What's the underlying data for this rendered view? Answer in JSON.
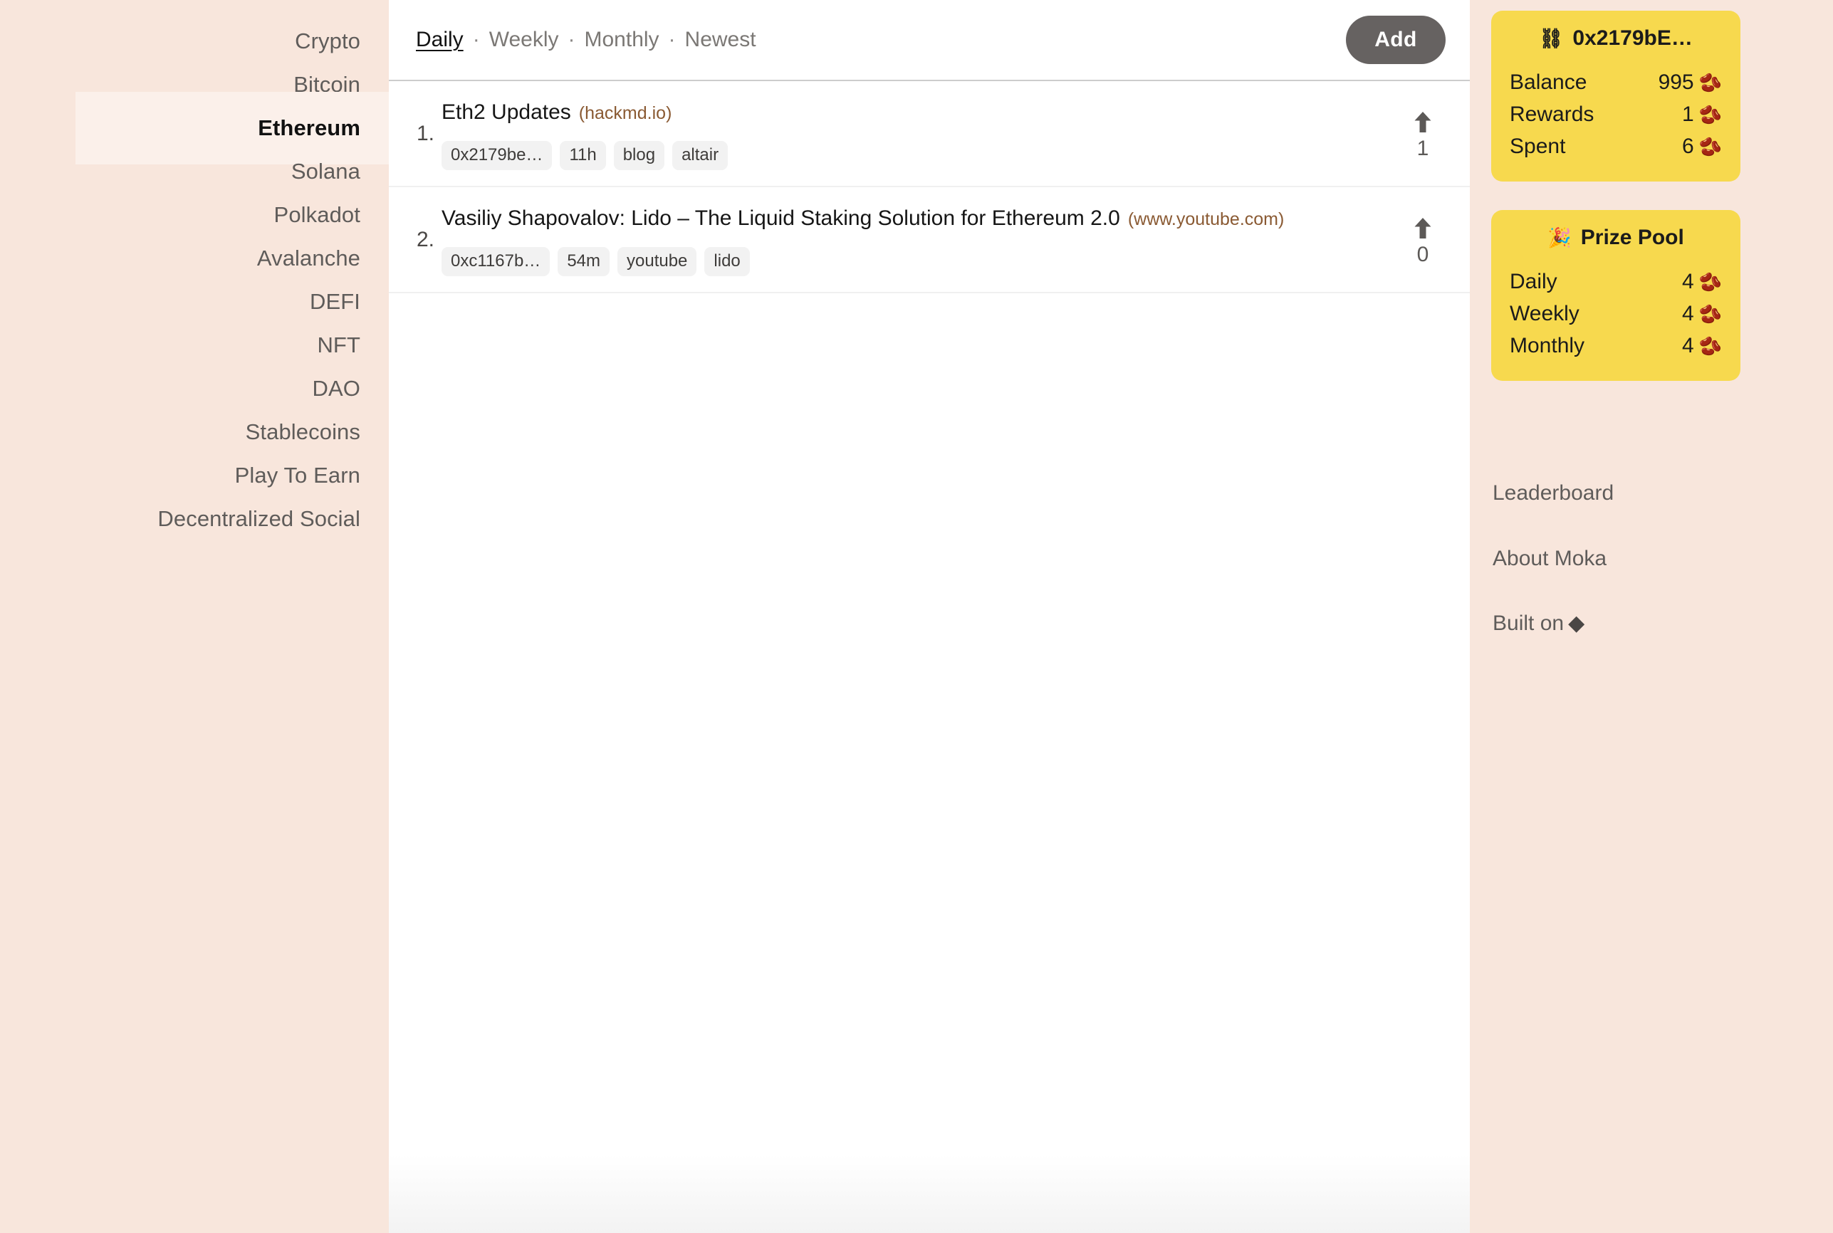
{
  "colors": {
    "page_background": "#f8e6dc",
    "panel_background": "#ffffff",
    "active_nav_background": "#fbf0ea",
    "card_yellow": "#f7d94e",
    "domain_link": "#8a5a33",
    "add_button": "#666261",
    "tag_pill": "#f2f2f2"
  },
  "sidebar": {
    "items": [
      {
        "label": "Crypto",
        "active": false
      },
      {
        "label": "Bitcoin",
        "active": false
      },
      {
        "label": "Ethereum",
        "active": true
      },
      {
        "label": "Solana",
        "active": false
      },
      {
        "label": "Polkadot",
        "active": false
      },
      {
        "label": "Avalanche",
        "active": false
      },
      {
        "label": "DEFI",
        "active": false
      },
      {
        "label": "NFT",
        "active": false
      },
      {
        "label": "DAO",
        "active": false
      },
      {
        "label": "Stablecoins",
        "active": false
      },
      {
        "label": "Play To Earn",
        "active": false
      },
      {
        "label": "Decentralized Social",
        "active": false
      }
    ]
  },
  "toolbar": {
    "tabs": [
      {
        "label": "Daily",
        "active": true
      },
      {
        "label": "Weekly",
        "active": false
      },
      {
        "label": "Monthly",
        "active": false
      },
      {
        "label": "Newest",
        "active": false
      }
    ],
    "separator": "·",
    "add_label": "Add"
  },
  "posts": [
    {
      "rank": "1.",
      "title": "Eth2 Updates",
      "domain": "(hackmd.io)",
      "tags": [
        "0x2179be…",
        "11h",
        "blog",
        "altair"
      ],
      "votes": "1",
      "vote_icon": "upvote-arrow-icon"
    },
    {
      "rank": "2.",
      "title": "Vasiliy Shapovalov: Lido – The Liquid Staking Solution for Ethereum 2.0",
      "domain": "(www.youtube.com)",
      "tags": [
        "0xc1167b…",
        "54m",
        "youtube",
        "lido"
      ],
      "votes": "0",
      "vote_icon": "upvote-arrow-icon"
    }
  ],
  "wallet_card": {
    "icon": "chains-icon",
    "icon_glyph": "⛓",
    "address": "0x2179bE…",
    "rows": [
      {
        "label": "Balance",
        "value": "995",
        "unit_icon": "coffee-bean-icon",
        "unit_glyph": "🫘"
      },
      {
        "label": "Rewards",
        "value": "1",
        "unit_icon": "coffee-bean-icon",
        "unit_glyph": "🫘"
      },
      {
        "label": "Spent",
        "value": "6",
        "unit_icon": "coffee-bean-icon",
        "unit_glyph": "🫘"
      }
    ]
  },
  "prize_card": {
    "icon": "party-popper-icon",
    "icon_glyph": "🎉",
    "title": "Prize Pool",
    "rows": [
      {
        "label": "Daily",
        "value": "4",
        "unit_icon": "coffee-bean-icon",
        "unit_glyph": "🫘"
      },
      {
        "label": "Weekly",
        "value": "4",
        "unit_icon": "coffee-bean-icon",
        "unit_glyph": "🫘"
      },
      {
        "label": "Monthly",
        "value": "4",
        "unit_icon": "coffee-bean-icon",
        "unit_glyph": "🫘"
      }
    ]
  },
  "side_links": {
    "leaderboard": "Leaderboard",
    "about": "About Moka",
    "built_on": "Built on",
    "built_on_glyph": "◆"
  }
}
